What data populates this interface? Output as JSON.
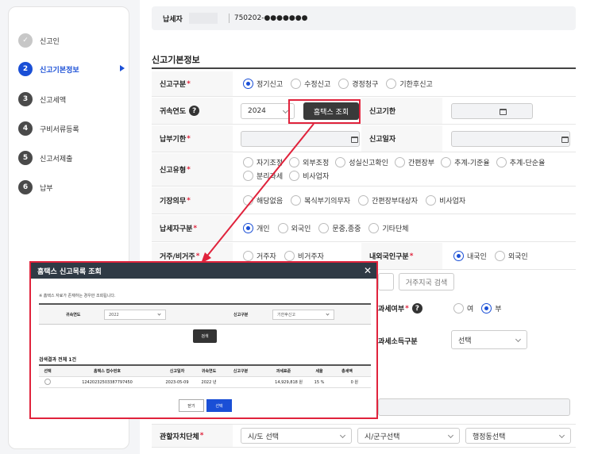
{
  "sidebar": {
    "steps": [
      {
        "num": "✓",
        "label": "신고인"
      },
      {
        "num": "2",
        "label": "신고기본정보"
      },
      {
        "num": "3",
        "label": "신고세액"
      },
      {
        "num": "4",
        "label": "구비서류등록"
      },
      {
        "num": "5",
        "label": "신고서제출"
      },
      {
        "num": "6",
        "label": "납부"
      }
    ]
  },
  "taxpayer": {
    "label": "납세자",
    "id": "750202-●●●●●●●"
  },
  "section_title": "신고기본정보",
  "form": {
    "report_type": {
      "label": "신고구분",
      "options": [
        "정기신고",
        "수정신고",
        "경정청구",
        "기한후신고"
      ]
    },
    "year": {
      "label": "귀속연도",
      "value": "2024",
      "hometax_button": "홈택스 조회",
      "deadline_label": "신고기한"
    },
    "pay_deadline": {
      "label": "납부기한",
      "report_date_label": "신고일자"
    },
    "report_kind": {
      "label": "신고유형",
      "options": [
        "자기조정",
        "외부조정",
        "성실신고확인",
        "간편장부",
        "추계-기준율",
        "추계-단순율",
        "분리과세",
        "비사업자"
      ]
    },
    "bookkeeping": {
      "label": "기장의무",
      "options": [
        "해당없음",
        "복식부기의무자",
        "간편장부대상자",
        "비사업자"
      ]
    },
    "taxpayer_type": {
      "label": "납세자구분",
      "options": [
        "개인",
        "외국인",
        "문중,종중",
        "기타단체"
      ]
    },
    "residency": {
      "label": "거주/비거주",
      "options": [
        "거주자",
        "비거주자"
      ],
      "nationality_label": "내외국인구분",
      "nationality_options": [
        "내국인",
        "외국인"
      ]
    },
    "residence_country_button": "거주지국 검색",
    "separate_tax": {
      "label_suffix": "과세여부",
      "options": [
        "여",
        "부"
      ]
    },
    "separate_income": {
      "label_suffix": "과세소득구분",
      "select_placeholder": "선택"
    },
    "jurisdiction": {
      "label": "관할자치단체",
      "sido": "시/도 선택",
      "sigungu": "시/군구선택",
      "dong": "행정동선택"
    }
  },
  "modal": {
    "title": "홈택스 신고목록 조회",
    "note": "※ 홈택스 자료가 존재하는 경우만 조회됩니다.",
    "filter": {
      "year_label": "귀속연도",
      "year_value": "2022",
      "type_label": "신고구분",
      "type_value": "기한후신고"
    },
    "search_button": "검색",
    "result_title": "검색결과 전체 1건",
    "columns": [
      "선택",
      "홈택스 접수번호",
      "신고일자",
      "귀속연도",
      "신고구분",
      "과세표준",
      "세율",
      "총세액"
    ],
    "rows": [
      {
        "receipt_no": "124202325033877974​50",
        "date": "2023-05-09",
        "year": "2022 년",
        "type": "",
        "base": "14,929,818 원",
        "rate": "15 %",
        "total": "0 원"
      }
    ],
    "close_button": "닫기",
    "select_button": "선택"
  },
  "colors": {
    "accent": "#1a4fd6",
    "highlight": "#e0233c",
    "modal_header": "#2f3a45"
  }
}
